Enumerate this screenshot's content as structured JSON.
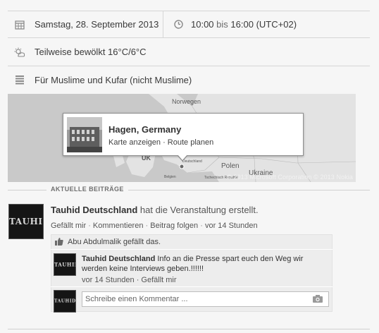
{
  "event": {
    "date": "Samstag, 28. September 2013",
    "time_start": "10:00",
    "time_sep": "bis",
    "time_end": "16:00",
    "timezone": "(UTC+02)",
    "weather": "Teilweise bewölkt 16°C/6°C",
    "description": "Für Muslime und Kufar (nicht Muslime)"
  },
  "map": {
    "labels": {
      "norwegen": "Norwegen",
      "uk": "UK",
      "polen": "Polen",
      "ukraine": "Ukraine",
      "deutschland": "Deutschland",
      "belgien": "Belgien",
      "tschechien": "Tschechisch Republik"
    },
    "copyright": "© 2013 Microsoft Corporation © 2013 Nokia",
    "popup": {
      "title": "Hagen, Germany",
      "link_map": "Karte anzeigen",
      "dot": "·",
      "link_route": "Route planen"
    }
  },
  "section_title": "AKTUELLE BEITRÄGE",
  "post": {
    "author": "Tauhid Deutschland",
    "action": "hat die Veranstaltung erstellt.",
    "avatar_text": "TAUHID",
    "meta": {
      "like": "Gefällt mir",
      "comment": "Kommentieren",
      "follow": "Beitrag folgen",
      "time": "vor 14 Stunden",
      "dot": "·"
    },
    "likes_text": "Abu Abdulmalik gefällt das.",
    "comment": {
      "author": "Tauhid Deutschland",
      "text": "Info an die Presse spart euch den Weg wir werden keine Interviews geben.!!!!!!",
      "time": "vor 14 Stunden",
      "like": "Gefällt mir",
      "dot": "·",
      "avatar_text": "TAUHID"
    },
    "input_placeholder": "Schreibe einen Kommentar ...",
    "input_avatar_text": "TAUHID"
  },
  "icons": {
    "calendar": "calendar-icon",
    "clock": "clock-icon",
    "weather": "weather-icon",
    "description": "text-lines-icon",
    "like": "thumbs-up-icon",
    "camera": "camera-icon"
  }
}
